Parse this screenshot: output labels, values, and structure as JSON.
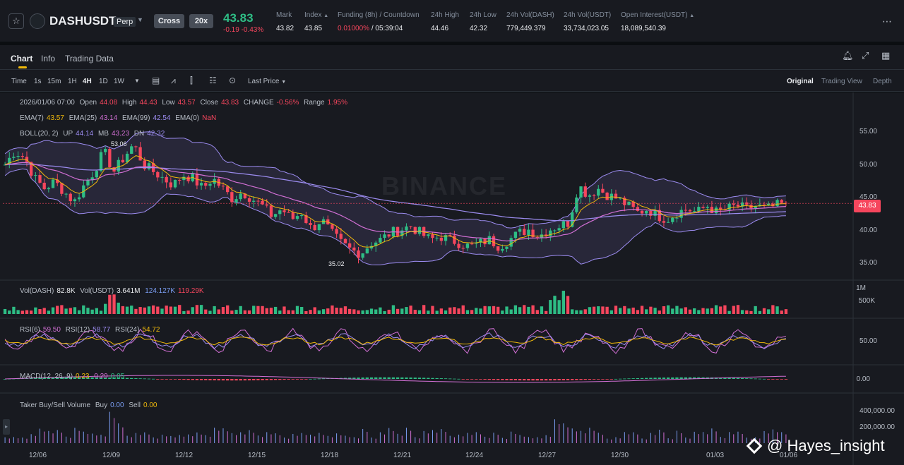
{
  "ticker": {
    "symbol": "DASHUSDT",
    "contract": "Perp",
    "margin_mode": "Cross",
    "leverage": "20x",
    "last_price": "43.83",
    "change": "-0.19 -0.43%",
    "stats": [
      {
        "label": "Mark",
        "value": "43.82"
      },
      {
        "label": "Index",
        "value": "43.85"
      },
      {
        "label": "Funding (8h) / Countdown",
        "value_red": "0.01000%",
        "value": " / 05:39:04"
      },
      {
        "label": "24h High",
        "value": "44.46"
      },
      {
        "label": "24h Low",
        "value": "42.32"
      },
      {
        "label": "24h Vol(DASH)",
        "value": "779,449.379"
      },
      {
        "label": "24h Vol(USDT)",
        "value": "33,734,023.05"
      },
      {
        "label": "Open Interest(USDT)",
        "value": "18,089,540.39"
      }
    ]
  },
  "tabs": [
    "Chart",
    "Info",
    "Trading Data"
  ],
  "toolbar": {
    "intervals": [
      "Time",
      "1s",
      "15m",
      "1H",
      "4H",
      "1D",
      "1W"
    ],
    "active_interval": "4H",
    "price_type": "Last Price",
    "views": [
      "Original",
      "Trading View",
      "Depth"
    ]
  },
  "ohlc": {
    "time": "2026/01/06 07:00",
    "open_label": "Open",
    "open": "44.08",
    "high_label": "High",
    "high": "44.43",
    "low_label": "Low",
    "low": "43.57",
    "close_label": "Close",
    "close": "43.83",
    "change_label": "CHANGE",
    "change": "-0.56%",
    "range_label": "Range",
    "range": "1.95%"
  },
  "ema": {
    "l1": "EMA(7)",
    "v1": "43.57",
    "l2": "EMA(25)",
    "v2": "43.14",
    "l3": "EMA(99)",
    "v3": "42.54",
    "l4": "EMA(0)",
    "v4": "NaN"
  },
  "boll": {
    "label": "BOLL(20, 2)",
    "up_l": "UP",
    "up": "44.14",
    "mb_l": "MB",
    "mb": "43.23",
    "dn_l": "DN",
    "dn": "42.32"
  },
  "vol": {
    "l1": "Vol(DASH)",
    "v1": "82.8K",
    "l2": "Vol(USDT)",
    "v2": "3.641M",
    "v3": "124.127K",
    "v4": "119.29K"
  },
  "rsi": {
    "l1": "RSI(6)",
    "v1": "59.50",
    "l2": "RSI(12)",
    "v2": "58.77",
    "l3": "RSI(24)",
    "v3": "54.72"
  },
  "macd": {
    "l1": "MACD(12, 26, 9)",
    "v1": "0.23",
    "v2": "0.29",
    "v3": "0.05"
  },
  "taker": {
    "label": "Taker Buy/Sell Volume",
    "buy_l": "Buy",
    "buy": "0.00",
    "sell_l": "Sell",
    "sell": "0.00"
  },
  "price_axis": [
    "55.00",
    "50.00",
    "45.00",
    "40.00",
    "35.00"
  ],
  "vol_axis": [
    "1M",
    "500K"
  ],
  "rsi_axis": "50.00",
  "macd_axis": "0.00",
  "taker_axis": [
    "400,000.00",
    "200,000.00"
  ],
  "current_price_tag": "43.83",
  "marked_high": "53.06",
  "marked_low": "35.02",
  "dates": [
    "12/06",
    "12/09",
    "12/12",
    "12/15",
    "12/18",
    "12/21",
    "12/24",
    "12/27",
    "12/30",
    "01/03",
    "01/06"
  ],
  "watermark": "BINANCE",
  "credit": "@ Hayes_insight",
  "colors": {
    "up": "#2ebd85",
    "down": "#f6465d",
    "ema7": "#f0b90b",
    "ema25": "#d16fd4",
    "ema99": "#9c8cf0",
    "accent": "#f0b90b"
  },
  "chart_data": {
    "type": "candlestick",
    "interval": "4H",
    "x_range": [
      "12/06",
      "01/06"
    ],
    "ylim": [
      33,
      58
    ],
    "close_path": [
      49.5,
      51.5,
      50.5,
      47.5,
      46.0,
      47.0,
      45.5,
      44.0,
      46.5,
      48.5,
      51.5,
      48.5,
      50.5,
      52.5,
      49.5,
      48.5,
      47.5,
      46.5,
      48.0,
      47.5,
      46.0,
      47.5,
      46.0,
      44.5,
      45.5,
      44.5,
      43.5,
      42.0,
      43.0,
      41.5,
      42.5,
      40.0,
      41.5,
      39.5,
      38.0,
      37.0,
      36.5,
      38.0,
      38.5,
      39.5,
      40.0,
      40.5,
      39.5,
      38.5,
      39.0,
      38.5,
      38.0,
      37.5,
      38.0,
      38.5,
      37.5,
      38.5,
      39.5,
      40.0,
      39.0,
      40.0,
      40.5,
      41.0,
      46.5,
      45.0,
      46.0,
      45.0,
      44.5,
      43.5,
      42.5,
      43.0,
      42.0,
      41.5,
      42.5,
      43.0,
      42.5,
      43.5,
      42.5,
      43.0,
      43.5,
      43.0,
      43.5,
      43.0,
      43.5,
      43.83
    ]
  }
}
